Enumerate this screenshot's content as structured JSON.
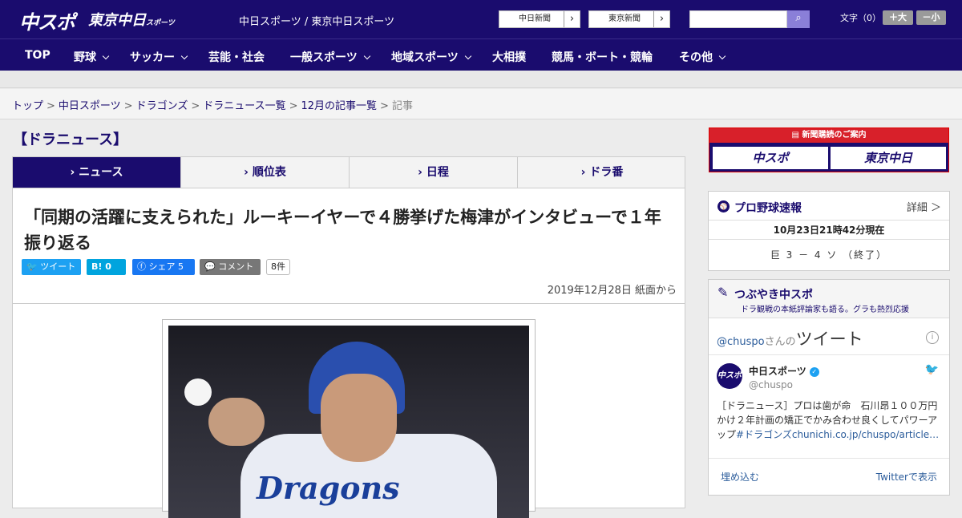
{
  "header": {
    "logo_main": "中スポ",
    "logo_tokyo": "東京中日",
    "logo_tokyo_small": "スポーツ",
    "site_link": "中日スポーツ / 東京中日スポーツ",
    "paper_buttons": [
      "中日新聞",
      "東京新聞"
    ],
    "font_size_label": "文字（0）",
    "font_plus": "＋大",
    "font_minus": "－小"
  },
  "nav": [
    {
      "label": "TOP",
      "chevron": false
    },
    {
      "label": "野球",
      "chevron": true
    },
    {
      "label": "サッカー",
      "chevron": true
    },
    {
      "label": "芸能・社会",
      "chevron": false
    },
    {
      "label": "一般スポーツ",
      "chevron": true
    },
    {
      "label": "地域スポーツ",
      "chevron": true
    },
    {
      "label": "大相撲",
      "chevron": false
    },
    {
      "label": "競馬・ボート・競輪",
      "chevron": false
    },
    {
      "label": "その他",
      "chevron": true
    }
  ],
  "breadcrumb": {
    "links": [
      "トップ",
      "中日スポーツ",
      "ドラゴンズ",
      "ドラニュース一覧",
      "12月の記事一覧"
    ],
    "current": "記事"
  },
  "section_title": "【ドラニュース】",
  "tabs": [
    {
      "label": "ニュース",
      "active": true
    },
    {
      "label": "順位表",
      "active": false
    },
    {
      "label": "日程",
      "active": false
    },
    {
      "label": "ドラ番",
      "active": false
    }
  ],
  "article": {
    "headline": "「同期の活躍に支えられた」ルーキーイヤーで４勝挙げた梅津がインタビューで１年振り返る",
    "share": {
      "tweet": "ツイート",
      "hatena_icon": "B!",
      "hatena_count": "0",
      "fb_label": "シェア",
      "fb_count": "5",
      "comment": "コメント",
      "comment_count": "8件"
    },
    "date": "2019年12月28日 紙面から",
    "photo_jersey_text": "Dragons"
  },
  "sidebar": {
    "subscribe_header": "新聞購読のご案内",
    "subscribe_buttons": [
      "中スポ",
      "東京中日"
    ],
    "score": {
      "title": "プロ野球速報",
      "detail": "詳細 ＞",
      "time": "10月23日21時42分現在",
      "line": "巨 3 － 4 ソ （終了）"
    },
    "tweets": {
      "title": "つぶやき中スポ",
      "subtitle": "ドラ観戦の本紙評論家も語る。グラも熱烈応援",
      "user_handle_link": "@chuspo",
      "san_no": "さんの",
      "tweet_word": "ツイート",
      "account_name": "中日スポーツ",
      "account_handle": "@chuspo",
      "text": "［ドラニュース］プロは歯が命　石川昂１００万円かけ２年計画の矯正でかみ合わせ良くしてパワーアップ",
      "hashtag": "#ドラゴンズ",
      "link": "chunichi.co.jp/chuspo/article…",
      "embed": "埋め込む",
      "view_on": "Twitterで表示"
    }
  },
  "colors": {
    "brand": "#1a0c6e",
    "accent_red": "#d8202a",
    "twitter": "#1da1f2",
    "facebook": "#1877f2"
  }
}
